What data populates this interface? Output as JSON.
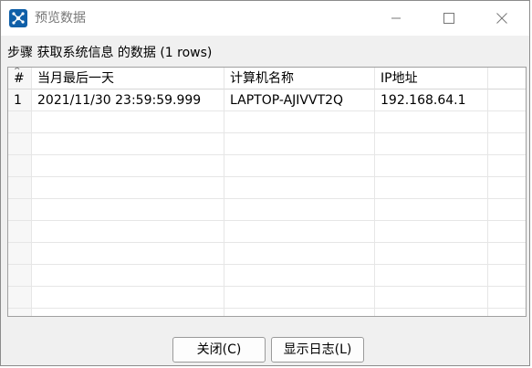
{
  "window": {
    "title": "预览数据",
    "icon": "app-network-icon"
  },
  "caption": "步骤 获取系统信息 的数据  (1 rows)",
  "grid": {
    "row_header_label": "#",
    "columns": [
      "当月最后一天",
      "计算机名称",
      "IP地址"
    ],
    "rows": [
      {
        "index": "1",
        "cells": [
          "2021/11/30 23:59:59.999",
          "LAPTOP-AJIVVT2Q",
          "192.168.64.1"
        ]
      }
    ]
  },
  "buttons": {
    "close": "关闭(C)",
    "show_log": "显示日志(L)"
  },
  "colors": {
    "accent": "#0f5fa8",
    "title_text": "#777777"
  }
}
